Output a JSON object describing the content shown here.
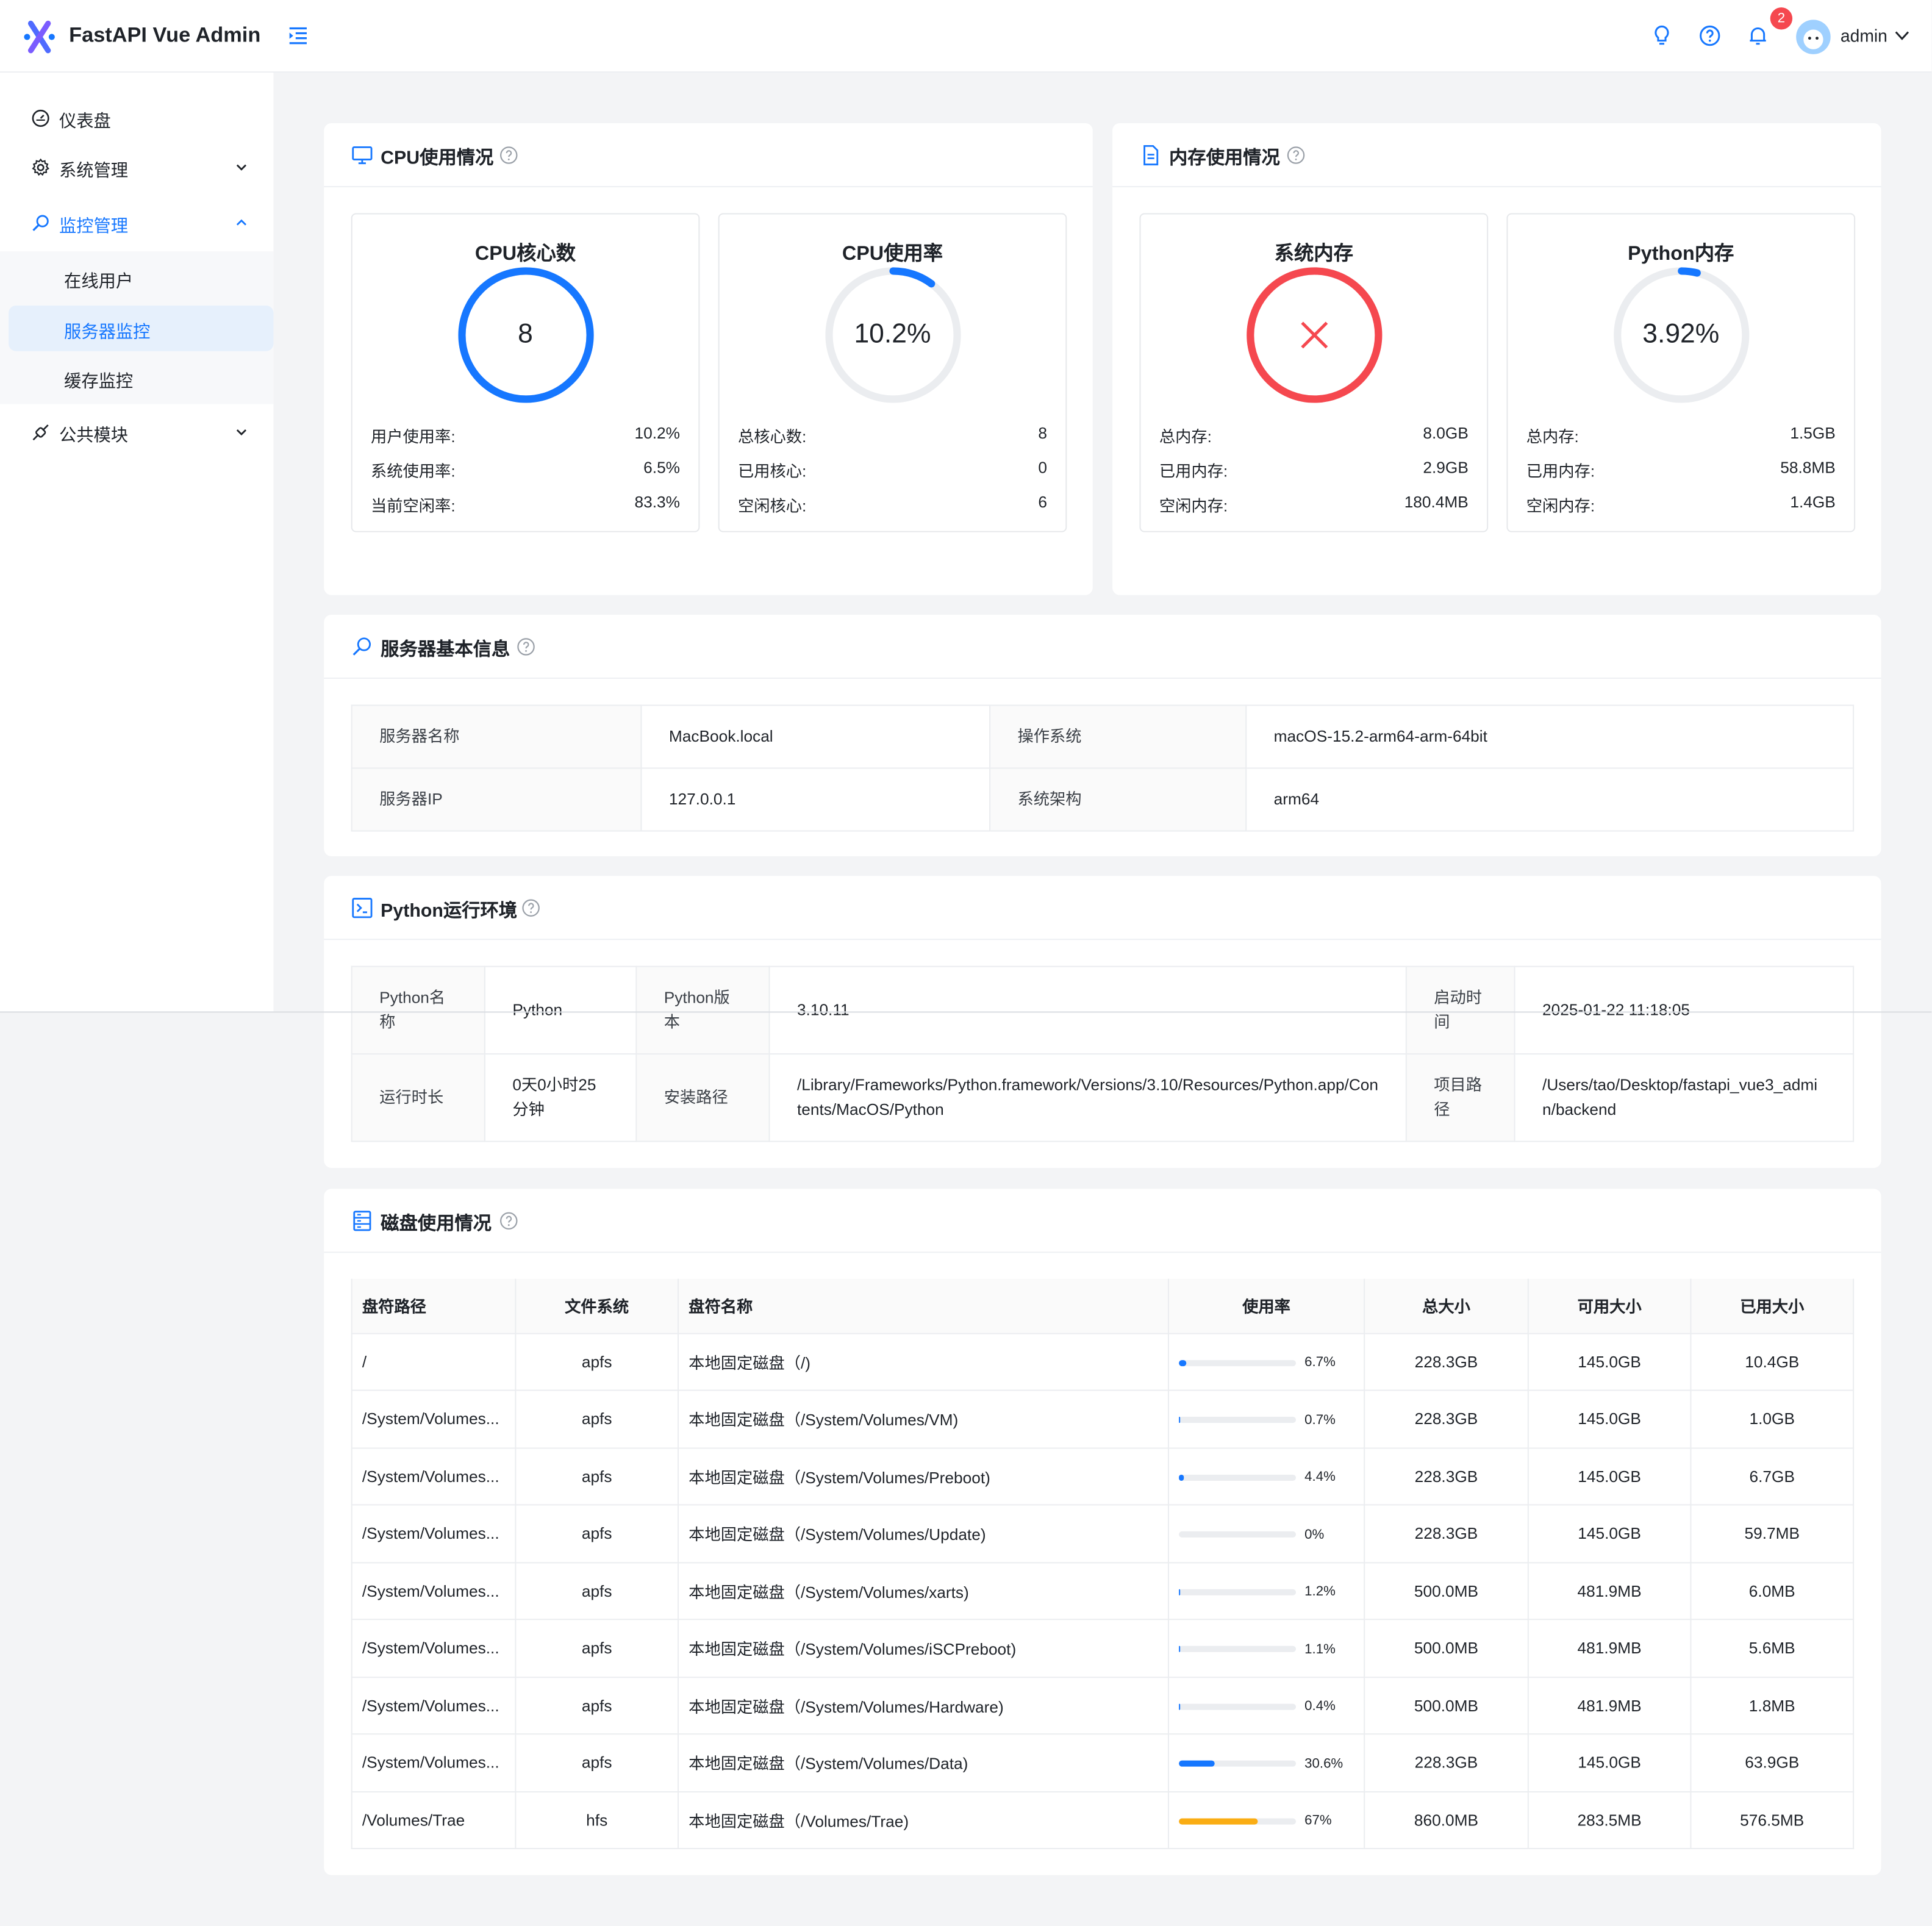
{
  "app": {
    "title": "FastAPI Vue Admin"
  },
  "header": {
    "notification_count": "2",
    "username": "admin"
  },
  "sidebar": {
    "items": [
      {
        "label": "仪表盘"
      },
      {
        "label": "系统管理"
      },
      {
        "label": "监控管理"
      },
      {
        "label": "公共模块"
      }
    ],
    "sub_items": [
      {
        "label": "在线用户"
      },
      {
        "label": "服务器监控"
      },
      {
        "label": "缓存监控"
      }
    ]
  },
  "cpu": {
    "card_title": "CPU使用情况",
    "cores": {
      "title": "CPU核心数",
      "value": "8",
      "percent": 100,
      "rows": [
        {
          "k": "用户使用率:",
          "v": "10.2%"
        },
        {
          "k": "系统使用率:",
          "v": "6.5%"
        },
        {
          "k": "当前空闲率:",
          "v": "83.3%"
        }
      ]
    },
    "usage": {
      "title": "CPU使用率",
      "value": "10.2%",
      "percent": 10.2,
      "rows": [
        {
          "k": "总核心数:",
          "v": "8"
        },
        {
          "k": "已用核心:",
          "v": "0"
        },
        {
          "k": "空闲核心:",
          "v": "6"
        }
      ]
    }
  },
  "memory": {
    "card_title": "内存使用情况",
    "system": {
      "title": "系统内存",
      "value": "×",
      "percent": 100,
      "rows": [
        {
          "k": "总内存:",
          "v": "8.0GB"
        },
        {
          "k": "已用内存:",
          "v": "2.9GB"
        },
        {
          "k": "空闲内存:",
          "v": "180.4MB"
        }
      ]
    },
    "python": {
      "title": "Python内存",
      "value": "3.92%",
      "percent": 3.92,
      "rows": [
        {
          "k": "总内存:",
          "v": "1.5GB"
        },
        {
          "k": "已用内存:",
          "v": "58.8MB"
        },
        {
          "k": "空闲内存:",
          "v": "1.4GB"
        }
      ]
    }
  },
  "server": {
    "card_title": "服务器基本信息",
    "name_label": "服务器名称",
    "name": "MacBook.local",
    "os_label": "操作系统",
    "os": "macOS-15.2-arm64-arm-64bit",
    "ip_label": "服务器IP",
    "ip": "127.0.0.1",
    "arch_label": "系统架构",
    "arch": "arm64"
  },
  "python_env": {
    "card_title": "Python运行环境",
    "name_label": "Python名称",
    "name": "Python",
    "version_label": "Python版本",
    "version": "3.10.11",
    "start_label": "启动时间",
    "start": "2025-01-22 11:18:05",
    "runtime_label": "运行时长",
    "runtime": "0天0小时25分钟",
    "install_label": "安装路径",
    "install": "/Library/Frameworks/Python.framework/Versions/3.10/Resources/Python.app/Contents/MacOS/Python",
    "project_label": "项目路径",
    "project": "/Users/tao/Desktop/fastapi_vue3_admin/backend"
  },
  "disk": {
    "card_title": "磁盘使用情况",
    "columns": [
      "盘符路径",
      "文件系统",
      "盘符名称",
      "使用率",
      "总大小",
      "可用大小",
      "已用大小"
    ],
    "rows": [
      {
        "path": "/",
        "fs": "apfs",
        "name": "本地固定磁盘（/)",
        "pct": 6.7,
        "pct_text": "6.7%",
        "total": "228.3GB",
        "free": "145.0GB",
        "used": "10.4GB"
      },
      {
        "path": "/System/Volumes...",
        "fs": "apfs",
        "name": "本地固定磁盘（/System/Volumes/VM)",
        "pct": 0.7,
        "pct_text": "0.7%",
        "total": "228.3GB",
        "free": "145.0GB",
        "used": "1.0GB"
      },
      {
        "path": "/System/Volumes...",
        "fs": "apfs",
        "name": "本地固定磁盘（/System/Volumes/Preboot)",
        "pct": 4.4,
        "pct_text": "4.4%",
        "total": "228.3GB",
        "free": "145.0GB",
        "used": "6.7GB"
      },
      {
        "path": "/System/Volumes...",
        "fs": "apfs",
        "name": "本地固定磁盘（/System/Volumes/Update)",
        "pct": 0,
        "pct_text": "0%",
        "total": "228.3GB",
        "free": "145.0GB",
        "used": "59.7MB"
      },
      {
        "path": "/System/Volumes...",
        "fs": "apfs",
        "name": "本地固定磁盘（/System/Volumes/xarts)",
        "pct": 1.2,
        "pct_text": "1.2%",
        "total": "500.0MB",
        "free": "481.9MB",
        "used": "6.0MB"
      },
      {
        "path": "/System/Volumes...",
        "fs": "apfs",
        "name": "本地固定磁盘（/System/Volumes/iSCPreboot)",
        "pct": 1.1,
        "pct_text": "1.1%",
        "total": "500.0MB",
        "free": "481.9MB",
        "used": "5.6MB"
      },
      {
        "path": "/System/Volumes...",
        "fs": "apfs",
        "name": "本地固定磁盘（/System/Volumes/Hardware)",
        "pct": 0.4,
        "pct_text": "0.4%",
        "total": "500.0MB",
        "free": "481.9MB",
        "used": "1.8MB"
      },
      {
        "path": "/System/Volumes...",
        "fs": "apfs",
        "name": "本地固定磁盘（/System/Volumes/Data)",
        "pct": 30.6,
        "pct_text": "30.6%",
        "total": "228.3GB",
        "free": "145.0GB",
        "used": "63.9GB"
      },
      {
        "path": "/Volumes/Trae",
        "fs": "hfs",
        "name": "本地固定磁盘（/Volumes/Trae)",
        "pct": 67,
        "pct_text": "67%",
        "total": "860.0MB",
        "free": "283.5MB",
        "used": "576.5MB"
      }
    ]
  },
  "colors": {
    "primary": "#1677ff",
    "danger": "#f5484f",
    "warning": "#faad14",
    "track": "#ebedf0"
  }
}
